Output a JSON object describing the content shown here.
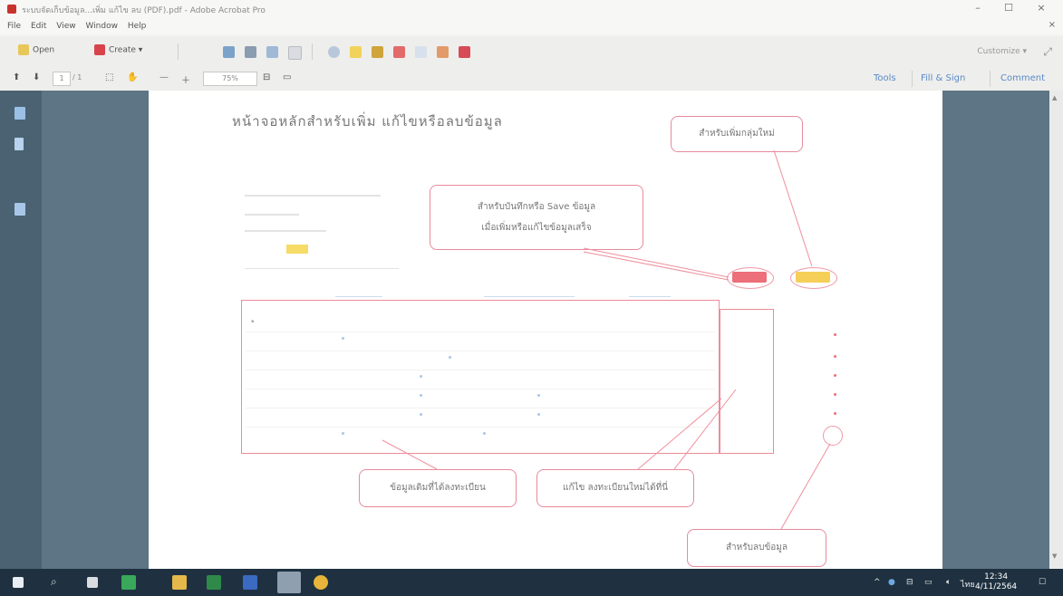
{
  "window": {
    "title": "ระบบจัดเก็บข้อมูล...เพิ่ม แก้ไข ลบ (PDF).pdf - Adobe Acrobat Pro",
    "minimize": "–",
    "maximize": "☐",
    "close": "×"
  },
  "menu": [
    "File",
    "Edit",
    "View",
    "Window",
    "Help"
  ],
  "toolbar": {
    "open_label": "Open",
    "create_label": "Create ▾",
    "customize_label": "Customize ▾"
  },
  "nav": {
    "page_current": "1",
    "page_total": "/ 1",
    "zoom": "75%",
    "tools_label": "Tools",
    "fill_sign_label": "Fill & Sign",
    "comment_label": "Comment"
  },
  "document": {
    "heading": "หน้าจอหลักสำหรับเพิ่ม แก้ไขหรือลบข้อมูล",
    "callouts": {
      "add_new": "สำหรับเพิ่มกลุ่มใหม่",
      "save_line1": "สำหรับบันทึกหรือ Save ข้อมูล",
      "save_line2": "เมื่อเพิ่มหรือแก้ไขข้อมูลเสร็จ",
      "existing_data": "ข้อมูลเดิมที่ได้ลงทะเบียน",
      "edit_new": "แก้ไข ลงทะเบียนใหม่ได้ที่นี่",
      "delete": "สำหรับลบข้อมูล"
    }
  },
  "taskbar": {
    "lang": "ไทย",
    "time": "12:34",
    "date": "4/11/2564"
  },
  "colors": {
    "accent_red": "#ec6f7a",
    "accent_yellow": "#f6cf58",
    "callout_border": "#e78a9a",
    "link_blue": "#5a8ac8",
    "taskbar": "#1f3140"
  }
}
